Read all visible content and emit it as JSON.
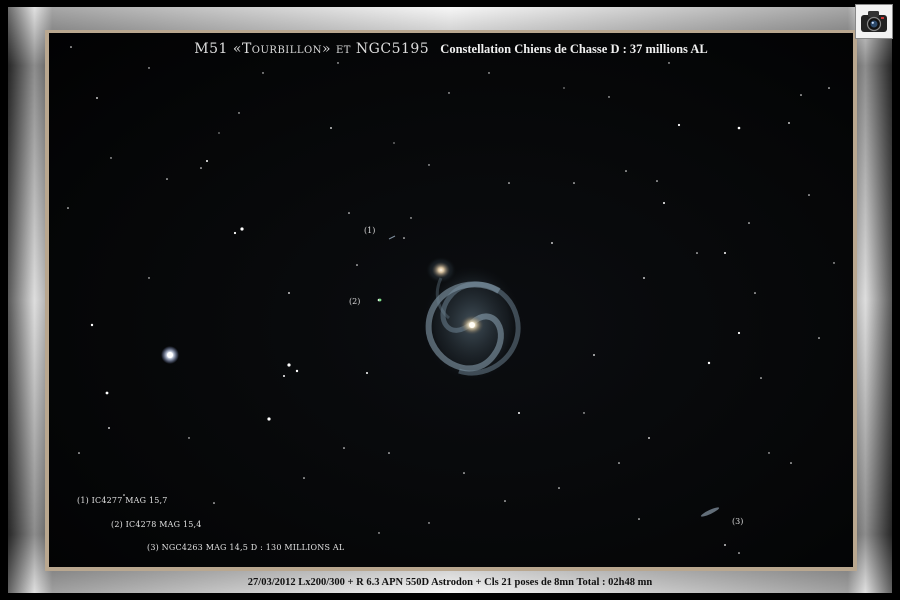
{
  "title": {
    "main": "M51 «Tourbillon» et NGC5195",
    "subtitle": "Constellation Chiens de Chasse  D : 37 millions AL"
  },
  "markers": {
    "m1": "(1)",
    "m2": "(2)",
    "m3": "(3)"
  },
  "legend": {
    "l1": "(1) IC4277 MAG 15,7",
    "l2": "(2) IC4278 MAG 15,4",
    "l3": "(3) NGC4263 MAG 14,5 D : 130 MILLIONS AL"
  },
  "caption": "27/03/2012   Lx200/300 + R 6.3    APN 550D Astrodon + Cls   21 poses de 8mn Total : 02h48 mn",
  "icons": {
    "camera": "camera-icon"
  },
  "colors": {
    "mat": "#b9a78f",
    "sky": "#050607",
    "galaxy_core": "#f4e8c8",
    "galaxy_arm": "#8fa7b8"
  }
}
